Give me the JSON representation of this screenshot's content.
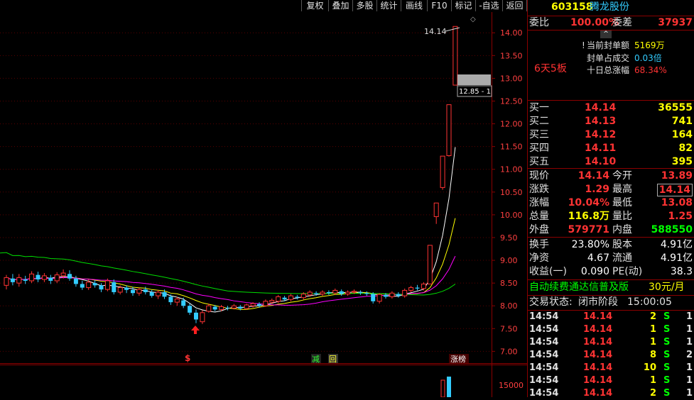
{
  "toolbar": {
    "buttons": [
      "复权",
      "叠加",
      "多股",
      "统计",
      "画线",
      "F10",
      "标记",
      "-自选",
      "返回"
    ]
  },
  "stock": {
    "code": "603158",
    "name": "腾龙股份"
  },
  "weibi": {
    "label1": "委比",
    "pct": "100.00%",
    "label2": "委差",
    "diff": "37937"
  },
  "seal": {
    "title_mark": "!",
    "amount_label": "当前封单额",
    "amount": "5169万",
    "ratio_label": "封单占成交",
    "ratio": "0.03倍",
    "gain_label": "十日总涨幅",
    "gain": "68.34%",
    "streak": "6天5板"
  },
  "bids": [
    {
      "label": "买一",
      "price": "14.14",
      "vol": "36555"
    },
    {
      "label": "买二",
      "price": "14.13",
      "vol": "741"
    },
    {
      "label": "买三",
      "price": "14.12",
      "vol": "164"
    },
    {
      "label": "买四",
      "price": "14.11",
      "vol": "82"
    },
    {
      "label": "买五",
      "price": "14.10",
      "vol": "395"
    }
  ],
  "quote": [
    {
      "l1": "现价",
      "v1": "14.14",
      "l2": "今开",
      "v2": "13.89"
    },
    {
      "l1": "涨跌",
      "v1": "1.29",
      "l2": "最高",
      "v2": "14.14"
    },
    {
      "l1": "涨幅",
      "v1": "10.04%",
      "l2": "最低",
      "v2": "13.08"
    },
    {
      "l1": "总量",
      "v1": "116.8万",
      "l2": "量比",
      "v2": "1.25"
    },
    {
      "l1": "外盘",
      "v1": "579771",
      "l2": "内盘",
      "v2": "588550"
    }
  ],
  "fund": [
    {
      "l1": "换手",
      "v1": "23.80%",
      "l2": "股本",
      "v2": "4.91亿"
    },
    {
      "l1": "净资",
      "v1": "4.67",
      "l2": "流通",
      "v2": "4.91亿"
    },
    {
      "l1": "收益(一)",
      "v1": "0.090",
      "l2": "PE(动)",
      "v2": "38.3"
    }
  ],
  "ad": {
    "text": "自动续费通达信普及版",
    "price": "30元/月"
  },
  "trade_state": {
    "label": "交易状态:",
    "state": "闭市阶段",
    "time": "15:00:05"
  },
  "ticks": [
    {
      "time": "14:54",
      "price": "14.14",
      "vol": "2",
      "dir": "S",
      "n": "1"
    },
    {
      "time": "14:54",
      "price": "14.14",
      "vol": "1",
      "dir": "S",
      "n": "1"
    },
    {
      "time": "14:54",
      "price": "14.14",
      "vol": "1",
      "dir": "S",
      "n": "1"
    },
    {
      "time": "14:54",
      "price": "14.14",
      "vol": "8",
      "dir": "S",
      "n": "2"
    },
    {
      "time": "14:54",
      "price": "14.14",
      "vol": "10",
      "dir": "S",
      "n": "1"
    },
    {
      "time": "14:54",
      "price": "14.14",
      "vol": "1",
      "dir": "S",
      "n": "1"
    },
    {
      "time": "14:54",
      "price": "14.14",
      "vol": "2",
      "dir": "S",
      "n": "1"
    }
  ],
  "chart_data": {
    "type": "candlestick",
    "y_ticks": [
      "14.00",
      "13.50",
      "13.00",
      "12.50",
      "12.00",
      "11.50",
      "11.00",
      "10.50",
      "10.00",
      "9.50",
      "9.00",
      "8.50",
      "8.00",
      "7.50",
      "7.00"
    ],
    "ylim": [
      6.85,
      14.3
    ],
    "annotations": {
      "high_label": "14.14",
      "price_label": "12.85 - 1",
      "markers": [
        "$",
        "减",
        "回",
        "涨榜"
      ],
      "volume_tick": "15000"
    },
    "candles": [
      [
        8.45,
        8.62,
        8.36,
        8.68
      ],
      [
        8.6,
        8.52,
        8.45,
        8.7
      ],
      [
        8.5,
        8.62,
        8.42,
        8.7
      ],
      [
        8.58,
        8.55,
        8.48,
        8.66
      ],
      [
        8.55,
        8.7,
        8.5,
        8.76
      ],
      [
        8.68,
        8.58,
        8.52,
        8.75
      ],
      [
        8.58,
        8.66,
        8.52,
        8.72
      ],
      [
        8.62,
        8.55,
        8.48,
        8.68
      ],
      [
        8.55,
        8.68,
        8.5,
        8.74
      ],
      [
        8.66,
        8.72,
        8.6,
        8.8
      ],
      [
        8.7,
        8.6,
        8.55,
        8.78
      ],
      [
        8.6,
        8.48,
        8.42,
        8.66
      ],
      [
        8.48,
        8.4,
        8.35,
        8.55
      ],
      [
        8.4,
        8.52,
        8.35,
        8.58
      ],
      [
        8.5,
        8.45,
        8.4,
        8.56
      ],
      [
        8.45,
        8.36,
        8.3,
        8.5
      ],
      [
        8.36,
        8.55,
        8.32,
        8.6
      ],
      [
        8.52,
        8.3,
        8.25,
        8.58
      ],
      [
        8.3,
        8.4,
        8.25,
        8.45
      ],
      [
        8.4,
        8.35,
        8.28,
        8.45
      ],
      [
        8.35,
        8.28,
        8.22,
        8.42
      ],
      [
        8.28,
        8.36,
        8.22,
        8.4
      ],
      [
        8.36,
        8.3,
        8.25,
        8.42
      ],
      [
        8.3,
        8.22,
        8.18,
        8.35
      ],
      [
        8.22,
        8.3,
        8.15,
        8.35
      ],
      [
        8.3,
        8.2,
        8.15,
        8.36
      ],
      [
        8.2,
        8.08,
        8.02,
        8.25
      ],
      [
        8.08,
        8.15,
        8.0,
        8.2
      ],
      [
        8.12,
        8.0,
        7.95,
        8.18
      ],
      [
        8.0,
        7.85,
        7.8,
        8.05
      ],
      [
        7.85,
        7.7,
        7.62,
        7.92
      ],
      [
        7.65,
        7.85,
        7.6,
        7.9
      ],
      [
        7.88,
        8.0,
        7.85,
        8.05
      ],
      [
        7.98,
        7.92,
        7.88,
        8.02
      ],
      [
        7.92,
        7.98,
        7.88,
        8.02
      ],
      [
        7.96,
        7.95,
        7.9,
        8.0
      ],
      [
        7.95,
        8.0,
        7.92,
        8.04
      ],
      [
        7.98,
        7.94,
        7.9,
        8.02
      ],
      [
        7.94,
        8.02,
        7.92,
        8.05
      ],
      [
        8.0,
        8.05,
        7.96,
        8.08
      ],
      [
        8.04,
        8.0,
        7.96,
        8.08
      ],
      [
        8.0,
        8.1,
        7.98,
        8.14
      ],
      [
        8.08,
        8.12,
        8.04,
        8.16
      ],
      [
        8.1,
        8.2,
        8.06,
        8.24
      ],
      [
        8.18,
        8.14,
        8.1,
        8.22
      ],
      [
        8.14,
        8.22,
        8.1,
        8.26
      ],
      [
        8.2,
        8.18,
        8.14,
        8.24
      ],
      [
        8.18,
        8.26,
        8.14,
        8.3
      ],
      [
        8.24,
        8.3,
        8.2,
        8.34
      ],
      [
        8.28,
        8.26,
        8.22,
        8.32
      ],
      [
        8.26,
        8.3,
        8.22,
        8.34
      ],
      [
        8.3,
        8.28,
        8.24,
        8.34
      ],
      [
        8.28,
        8.34,
        8.24,
        8.38
      ],
      [
        8.32,
        8.26,
        8.22,
        8.36
      ],
      [
        8.26,
        8.3,
        8.22,
        8.34
      ],
      [
        8.3,
        8.32,
        8.26,
        8.36
      ],
      [
        8.3,
        8.28,
        8.24,
        8.34
      ],
      [
        8.28,
        8.26,
        8.22,
        8.32
      ],
      [
        8.26,
        8.1,
        8.05,
        8.3
      ],
      [
        8.1,
        8.25,
        8.05,
        8.28
      ],
      [
        8.24,
        8.2,
        8.16,
        8.28
      ],
      [
        8.2,
        8.28,
        8.16,
        8.32
      ],
      [
        8.26,
        8.22,
        8.18,
        8.3
      ],
      [
        8.22,
        8.34,
        8.18,
        8.38
      ],
      [
        8.34,
        8.4,
        8.3,
        8.44
      ],
      [
        8.4,
        8.38,
        8.34,
        8.46
      ],
      [
        8.38,
        8.48,
        8.34,
        8.52
      ],
      [
        8.48,
        9.33,
        8.48,
        9.33
      ],
      [
        9.96,
        10.26,
        9.8,
        10.26
      ],
      [
        10.6,
        11.29,
        10.55,
        11.29
      ],
      [
        11.3,
        12.42,
        11.28,
        12.42
      ],
      [
        12.85,
        14.14,
        12.85,
        14.14
      ]
    ],
    "ma_lines": {
      "ma5": "white",
      "ma10": "yellow",
      "ma20": "magenta",
      "ma60": "green"
    }
  }
}
